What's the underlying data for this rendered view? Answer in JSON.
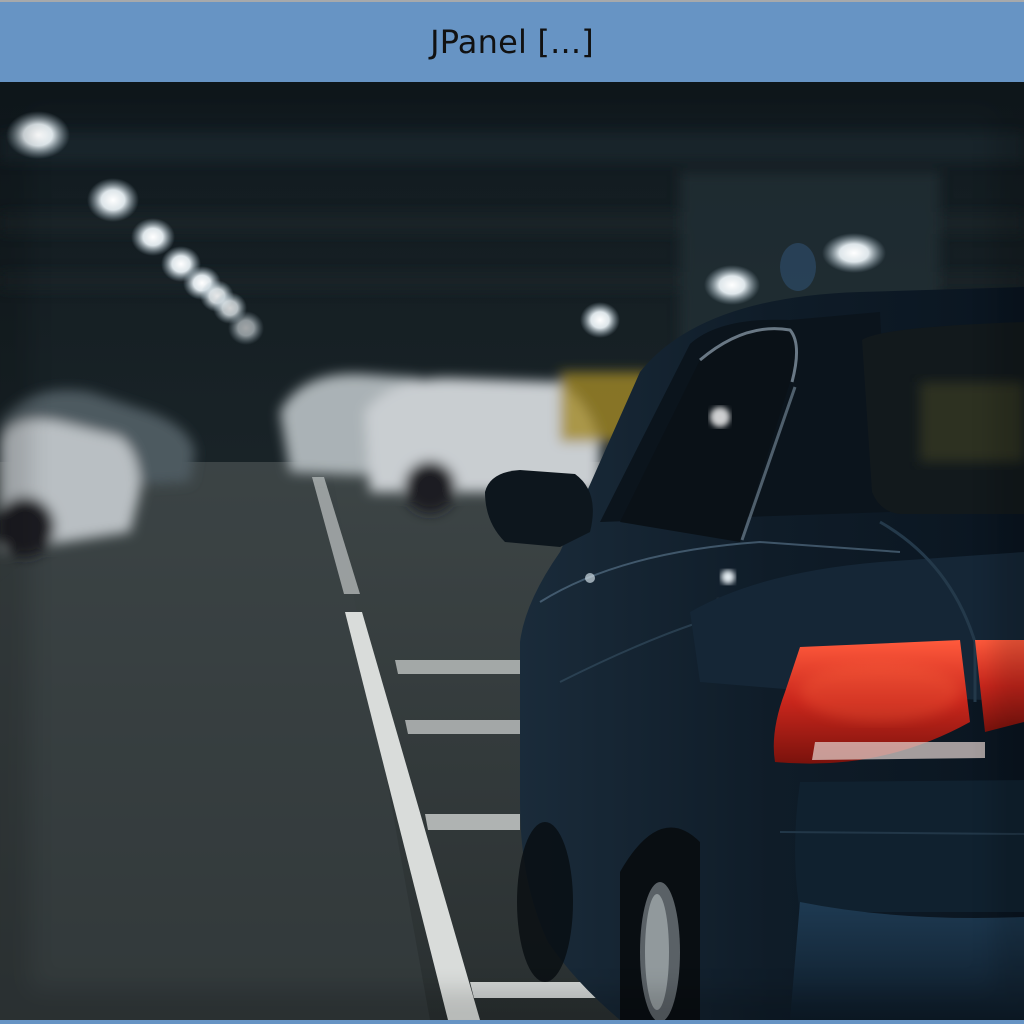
{
  "window": {
    "title": "JPanel [...]"
  },
  "panel": {
    "content": "photo",
    "colors": {
      "titlebar": "#6794c4",
      "background": "#0d1418",
      "taillight": "#c8261c"
    }
  }
}
